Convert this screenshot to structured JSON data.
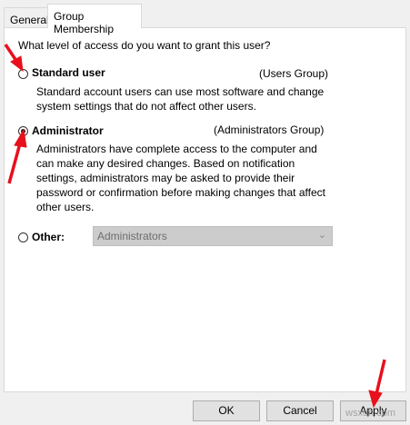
{
  "tabs": [
    {
      "label": "General"
    },
    {
      "label": "Group Membership"
    }
  ],
  "question": "What level of access do you want to grant this user?",
  "options": {
    "standard": {
      "label": "Standard user",
      "group": "(Users Group)",
      "description": "Standard account users can use most software and change system settings that do not affect other users."
    },
    "administrator": {
      "label": "Administrator",
      "group": "(Administrators Group)",
      "description": "Administrators have complete access to the computer and can make any desired changes. Based on notification settings, administrators may be asked to provide their password or confirmation before making changes that affect other users.",
      "selected": true
    },
    "other": {
      "label": "Other:",
      "select_value": "Administrators"
    }
  },
  "buttons": {
    "ok": "OK",
    "cancel": "Cancel",
    "apply": "Apply"
  },
  "watermark": "wsxdn.com",
  "colors": {
    "arrow": "#e8101c"
  }
}
